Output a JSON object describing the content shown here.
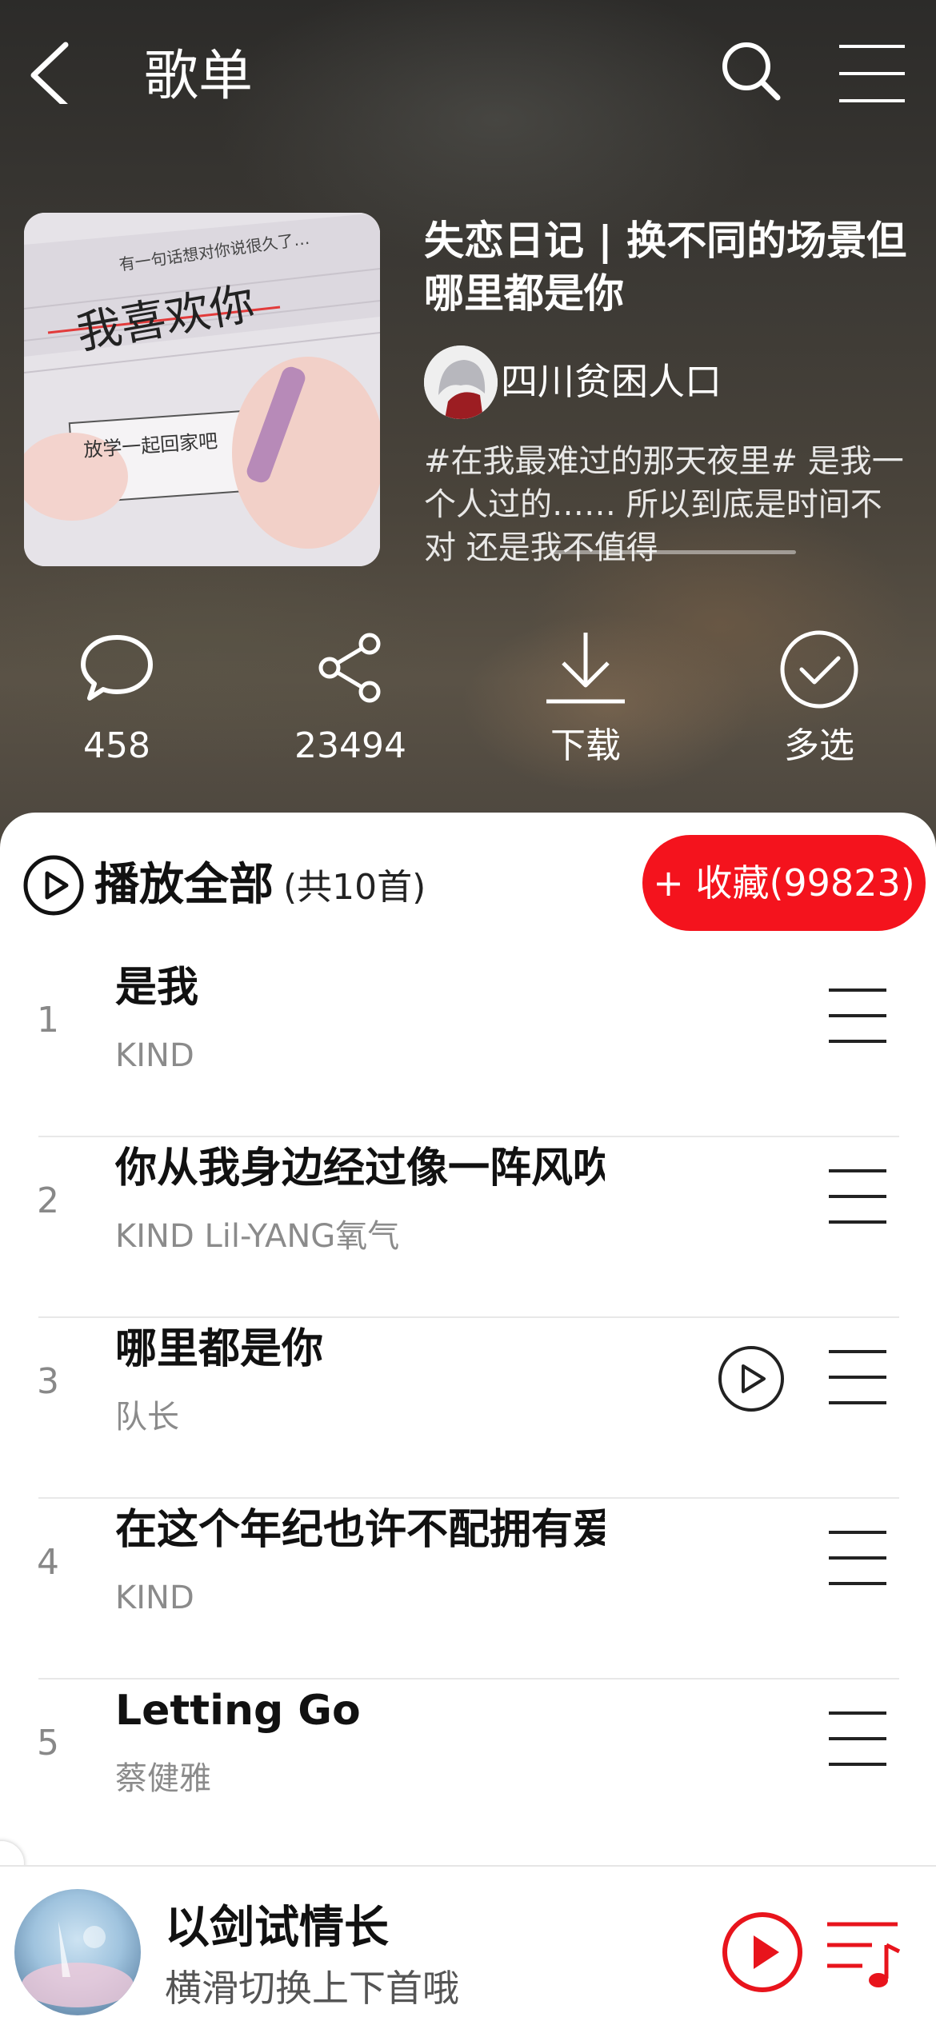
{
  "header": {
    "title": "歌单"
  },
  "playlist": {
    "title": "失恋日记 | 换不同的场景但哪里都是你",
    "creator": "四川贫困人口",
    "description": "#在我最难过的那天夜里# 是我一个人过的…… 所以到底是时间不对 还是我不值得",
    "cover_text": {
      "line1": "有一句话想对你说很久了…",
      "line2": "我喜欢你",
      "line3": "放学一起回家吧"
    }
  },
  "actions": {
    "comments": "458",
    "share": "23494",
    "download": "下载",
    "multiselect": "多选"
  },
  "playall": {
    "label": "播放全部",
    "count": "(共10首)"
  },
  "collect": {
    "label": "+ 收藏(99823)"
  },
  "songs": [
    {
      "num": "1",
      "title": "是我",
      "artist": "KIND"
    },
    {
      "num": "2",
      "title": "你从我身边经过像一阵风吹",
      "artist": "KIND  Lil-YANG氧气"
    },
    {
      "num": "3",
      "title": "哪里都是你",
      "artist": "队长"
    },
    {
      "num": "4",
      "title": "在这个年纪也许不配拥有爱",
      "artist": "KIND"
    },
    {
      "num": "5",
      "title": "Letting Go",
      "artist": "蔡健雅"
    }
  ],
  "player": {
    "title": "以剑试情长",
    "subtitle": "横滑切换上下首哦",
    "accent_color": "#e8141c"
  },
  "colors": {
    "brand_red": "#f4131d",
    "header_text": "#ffffff"
  }
}
